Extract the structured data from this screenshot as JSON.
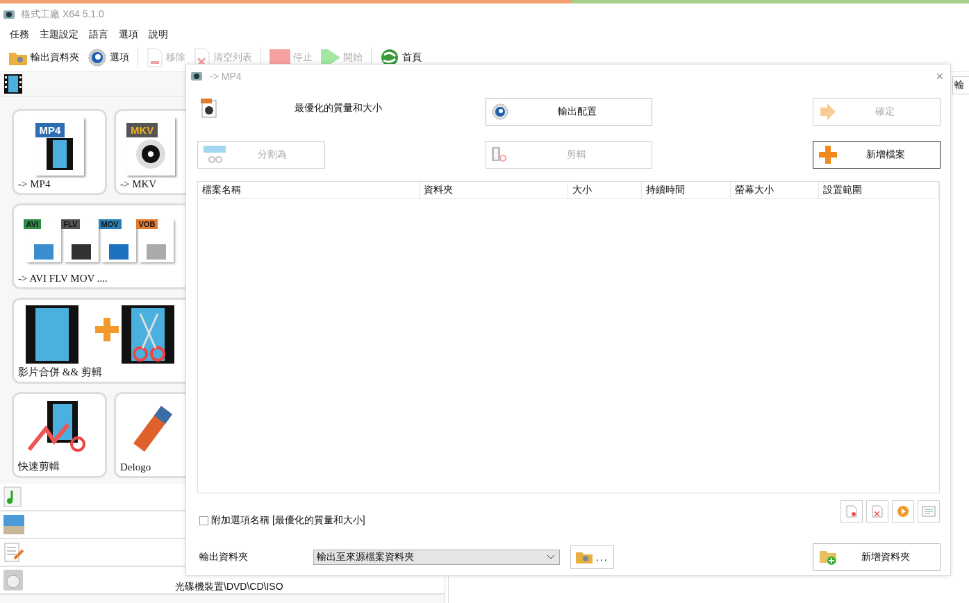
{
  "window": {
    "title": "格式工廠 X64 5.1.0"
  },
  "menu": [
    "任務",
    "主題設定",
    "語言",
    "選項",
    "說明"
  ],
  "toolbar": [
    {
      "label": "輸出資料夾",
      "kind": "folder",
      "disabled": false
    },
    {
      "label": "選項",
      "kind": "options",
      "disabled": false
    },
    {
      "label": "移除",
      "kind": "remove",
      "disabled": true
    },
    {
      "label": "清空列表",
      "kind": "clear",
      "disabled": true
    },
    {
      "label": "停止",
      "kind": "stop",
      "disabled": true
    },
    {
      "label": "開始",
      "kind": "start",
      "disabled": true
    },
    {
      "label": "首頁",
      "kind": "home",
      "disabled": false
    }
  ],
  "sidebar": {
    "tiles": [
      {
        "label": "-> MP4",
        "kind": "mp4",
        "badges": [
          "MP4"
        ]
      },
      {
        "label": "-> MKV",
        "kind": "mkv",
        "badges": [
          "MKV"
        ]
      },
      {
        "label": "-> AVI FLV MOV ....",
        "kind": "multi",
        "badges": [
          "AVI",
          "FLV",
          "MOV",
          "VOB"
        ]
      },
      {
        "label": "影片合併 && 剪輯",
        "kind": "merge"
      },
      {
        "label": "快速剪輯",
        "kind": "quickcut"
      },
      {
        "label": "Delogo",
        "kind": "delogo"
      }
    ],
    "categories": [
      {
        "kind": "audio"
      },
      {
        "kind": "image"
      },
      {
        "kind": "document"
      },
      {
        "kind": "disc",
        "label": "光碟機裝置\\DVD\\CD\\ISO"
      }
    ]
  },
  "right_tab": "輸",
  "dialog": {
    "title": "-> MP4",
    "close": "×",
    "profile": "最優化的質量和大小",
    "buttons": [
      {
        "label": "輸出配置",
        "kind": "config",
        "disabled": false,
        "default": false
      },
      {
        "label": "確定",
        "kind": "ok",
        "disabled": true,
        "default": false
      },
      {
        "label": "分割為",
        "kind": "split",
        "disabled": true,
        "default": false
      },
      {
        "label": "剪輯",
        "kind": "clip",
        "disabled": true,
        "default": false
      },
      {
        "label": "新增檔案",
        "kind": "add",
        "disabled": false,
        "default": true
      }
    ],
    "table": {
      "columns": [
        "檔案名稱",
        "資料夾",
        "大小",
        "持續時間",
        "螢幕大小",
        "設置範圍"
      ]
    },
    "tools": [
      {
        "kind": "remove"
      },
      {
        "kind": "clear"
      },
      {
        "kind": "play"
      },
      {
        "kind": "info"
      }
    ],
    "append_option": {
      "label": "附加選項名稱 [最優化的質量和大小]",
      "checked": false
    },
    "output": {
      "label": "輸出資料夾",
      "value": "輸出至來源檔案資料夾",
      "browse": "...",
      "new_folder": "新增資料夾"
    }
  }
}
